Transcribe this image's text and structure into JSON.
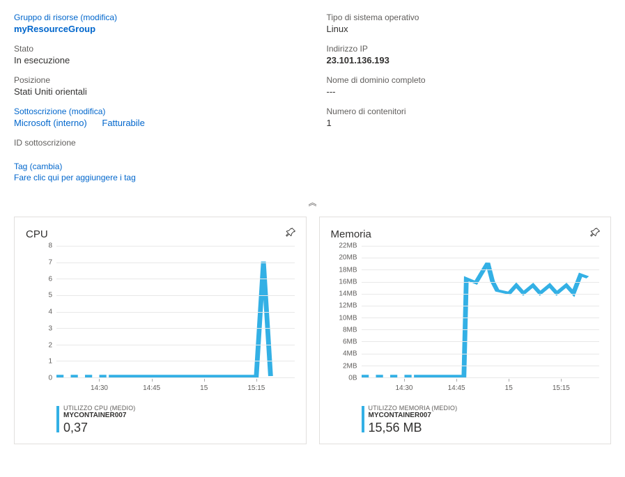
{
  "details": {
    "resource_group_label": "Gruppo di risorse (modifica)",
    "resource_group_value": "myResourceGroup",
    "status_label": "Stato",
    "status_value": "In esecuzione",
    "location_label": "Posizione",
    "location_value": "Stati Uniti orientali",
    "subscription_label": "Sottoscrizione (modifica)",
    "subscription_value": "Microsoft (interno)",
    "billable": "Fatturabile",
    "subscription_id_label": "ID sottoscrizione",
    "tags_label": "Tag (cambia)",
    "tags_add": "Fare clic qui per aggiungere i tag",
    "os_type_label": "Tipo di sistema operativo",
    "os_type_value": "Linux",
    "ip_label": "Indirizzo IP",
    "ip_value": "23.101.136.193",
    "fqdn_label": "Nome di dominio completo",
    "fqdn_value": "---",
    "container_count_label": "Numero di contenitori",
    "container_count_value": "1"
  },
  "cpu_card": {
    "title": "CPU",
    "metric_label": "UTILIZZO CPU (MEDIO)",
    "metric_name": "MYCONTAINER007",
    "metric_value": "0,37"
  },
  "mem_card": {
    "title": "Memoria",
    "metric_label": "UTILIZZO MEMORIA (MEDIO)",
    "metric_name": "MYCONTAINER007",
    "metric_value": "15,56 MB"
  },
  "chart_data": [
    {
      "type": "line",
      "title": "CPU",
      "ylabel": "",
      "ylim": [
        0,
        8
      ],
      "y_ticks": [
        0,
        1,
        2,
        3,
        4,
        5,
        6,
        7,
        8
      ],
      "x_ticks": [
        "14:30",
        "14:45",
        "15",
        "15:15"
      ],
      "series": [
        {
          "name": "MYCONTAINER007",
          "values_approx": {
            "14:15-15:15": 0.1,
            "15:18_spike": 7,
            "15:20": 0.1
          }
        }
      ]
    },
    {
      "type": "line",
      "title": "Memoria",
      "ylabel": "",
      "ylim": [
        0,
        22
      ],
      "y_unit": "MB",
      "y_ticks": [
        0,
        2,
        4,
        6,
        8,
        10,
        12,
        14,
        16,
        18,
        20,
        22
      ],
      "x_ticks": [
        "14:30",
        "14:45",
        "15",
        "15:15"
      ],
      "series": [
        {
          "name": "MYCONTAINER007",
          "values_approx": {
            "14:15-14:48": 0.2,
            "14:50": 19,
            "14:52-15:20_range": [
              14,
              17.5
            ],
            "15:22": 17
          }
        }
      ]
    }
  ]
}
